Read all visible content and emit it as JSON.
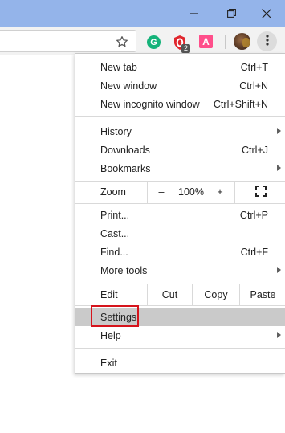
{
  "window_controls": {
    "minimize": "minimize-icon",
    "restore": "restore-icon",
    "close": "close-icon",
    "titlebar_color": "#94b4ea"
  },
  "toolbar": {
    "omnibox_value": "",
    "bookmark_icon": "star-icon",
    "extensions": [
      {
        "icon": "grammarly-extension-icon",
        "glyph": "G",
        "color": "#15b37a"
      },
      {
        "icon": "opera-adblock-extension-icon",
        "badge": "2",
        "color": "#e0262d"
      },
      {
        "icon": "anydo-extension-icon",
        "glyph": "A",
        "color": "#ff4f8b"
      }
    ],
    "profile_icon": "profile-avatar",
    "menu_icon": "kebab-menu-icon"
  },
  "menu": {
    "new_tab": {
      "label": "New tab",
      "shortcut": "Ctrl+T"
    },
    "new_window": {
      "label": "New window",
      "shortcut": "Ctrl+N"
    },
    "new_incognito": {
      "label": "New incognito window",
      "shortcut": "Ctrl+Shift+N"
    },
    "history": {
      "label": "History"
    },
    "downloads": {
      "label": "Downloads",
      "shortcut": "Ctrl+J"
    },
    "bookmarks": {
      "label": "Bookmarks"
    },
    "zoom": {
      "label": "Zoom",
      "minus": "–",
      "level": "100%",
      "plus": "+",
      "fullscreen_icon": "fullscreen-icon"
    },
    "print": {
      "label": "Print...",
      "shortcut": "Ctrl+P"
    },
    "cast": {
      "label": "Cast..."
    },
    "find": {
      "label": "Find...",
      "shortcut": "Ctrl+F"
    },
    "more_tools": {
      "label": "More tools"
    },
    "edit": {
      "label": "Edit",
      "cut": "Cut",
      "copy": "Copy",
      "paste": "Paste"
    },
    "settings": {
      "label": "Settings",
      "highlight_color": "#d6141c"
    },
    "help": {
      "label": "Help"
    },
    "exit": {
      "label": "Exit"
    }
  }
}
